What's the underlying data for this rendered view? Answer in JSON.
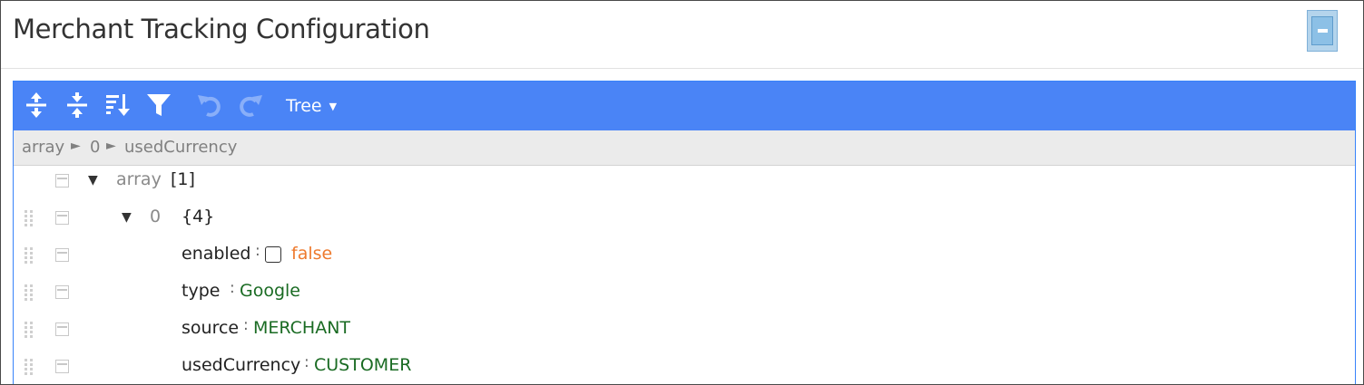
{
  "page": {
    "title": "Merchant Tracking Configuration"
  },
  "toolbar": {
    "mode_label": "Tree",
    "mode_caret": "▼"
  },
  "navbar": {
    "crumbs": [
      "array",
      "0",
      "usedCurrency"
    ],
    "separator": "►"
  },
  "tree": {
    "root": {
      "expander": "▼",
      "field": "array",
      "count": "[1]"
    },
    "item": {
      "expander": "▼",
      "field": "0",
      "count": "{4}"
    },
    "props": [
      {
        "field": "enabled",
        "separator": ":",
        "value": "false",
        "type": "boolean",
        "checked": false
      },
      {
        "field": "type",
        "separator": ":",
        "value": "Google",
        "type": "string"
      },
      {
        "field": "source",
        "separator": ":",
        "value": "MERCHANT",
        "type": "string"
      },
      {
        "field": "usedCurrency",
        "separator": ":",
        "value": "CUSTOMER",
        "type": "string"
      }
    ]
  },
  "icons": [
    "expand-all-icon",
    "collapse-all-icon",
    "sort-icon",
    "filter-icon",
    "undo-icon",
    "redo-icon",
    "minimize-icon"
  ],
  "colors": {
    "toolbar": "#4a84f6",
    "string_value": "#1a6b23",
    "boolean_value": "#ee7a2e"
  }
}
